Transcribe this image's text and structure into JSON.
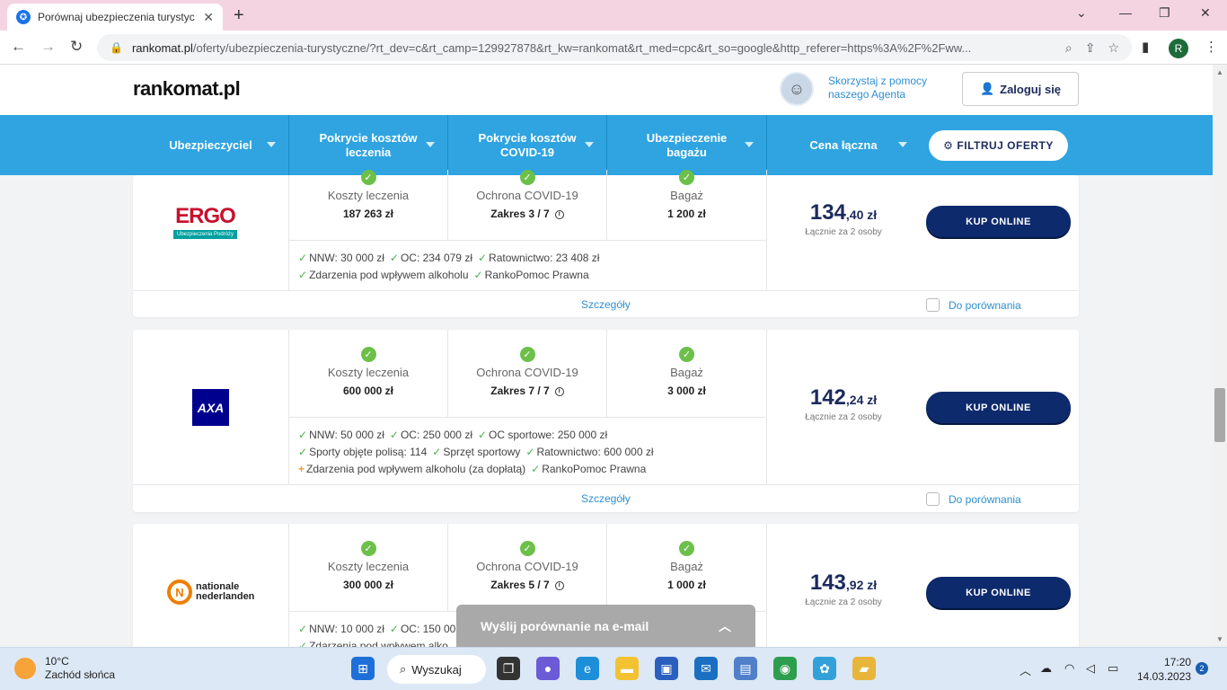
{
  "browser": {
    "tab_title": "Porównaj ubezpieczenia turystyc",
    "url_domain": "rankomat.pl",
    "url_path": "/oferty/ubezpieczenia-turystyczne/?rt_dev=c&rt_camp=129927878&rt_kw=rankomat&rt_med=cpc&rt_so=google&http_referer=https%3A%2F%2Fww...",
    "profile_initial": "R"
  },
  "header": {
    "logo": "rankomat.pl",
    "agent_text": "Skorzystaj z pomocy naszego Agenta",
    "login_label": "Zaloguj się"
  },
  "columns": {
    "insurer": "Ubezpieczyciel",
    "medical": "Pokrycie kosztów leczenia",
    "covid": "Pokrycie kosztów COVID-19",
    "luggage": "Ubezpieczenie bagażu",
    "price": "Cena łączna",
    "filter": "FILTRUJ OFERTY"
  },
  "labels": {
    "medical": "Koszty leczenia",
    "covid": "Ochrona COVID-19",
    "luggage": "Bagaż",
    "buy": "KUP ONLINE",
    "details": "Szczegóły",
    "compare": "Do porównania"
  },
  "offers": [
    {
      "insurer": "ERGO",
      "insurer_sub": "Ubezpieczenia Podróży",
      "medical": "187 263 zł",
      "covid": "Zakres 3 / 7",
      "luggage": "1 200 zł",
      "features_l1": [
        "NNW: 30 000 zł",
        "OC: 234 079 zł",
        "Ratownictwo: 23 408 zł"
      ],
      "features_l2": [
        "Zdarzenia pod wpływem alkoholu",
        "RankoPomoc Prawna"
      ],
      "price_int": "134",
      "price_dec": ",40 zł",
      "price_sub": "Łącznie za 2 osoby"
    },
    {
      "insurer": "AXA",
      "medical": "600 000 zł",
      "covid": "Zakres 7 / 7",
      "luggage": "3 000 zł",
      "features_l1": [
        "NNW: 50 000 zł",
        "OC: 250 000 zł",
        "OC sportowe: 250 000 zł"
      ],
      "features_l2": [
        "Sporty objęte polisą: 114",
        "Sprzęt sportowy",
        "Ratownictwo: 600 000 zł"
      ],
      "features_l3_extra": "Zdarzenia pod wpływem alkoholu (za dopłatą)",
      "features_l3": "RankoPomoc Prawna",
      "price_int": "142",
      "price_dec": ",24 zł",
      "price_sub": "Łącznie za 2 osoby"
    },
    {
      "insurer_l1": "nationale",
      "insurer_l2": "nederlanden",
      "medical": "300 000 zł",
      "covid": "Zakres 5 / 7",
      "luggage": "1 000 zł",
      "features_l1": [
        "NNW: 10 000 zł",
        "OC: 150 00"
      ],
      "features_l2": [
        "Zdarzenia pod wpływem alko"
      ],
      "price_int": "143",
      "price_dec": ",92 zł",
      "price_sub": "Łącznie za 2 osoby"
    }
  ],
  "email_bar": "Wyślij porównanie na e-mail",
  "taskbar": {
    "temp": "10°C",
    "weather": "Zachód słońca",
    "search": "Wyszukaj",
    "time": "17:20",
    "date": "14.03.2023",
    "notifications": "2"
  },
  "colors": {
    "accent": "#2fa4e0",
    "button": "#0d2a6c",
    "check": "#6cc04a"
  }
}
